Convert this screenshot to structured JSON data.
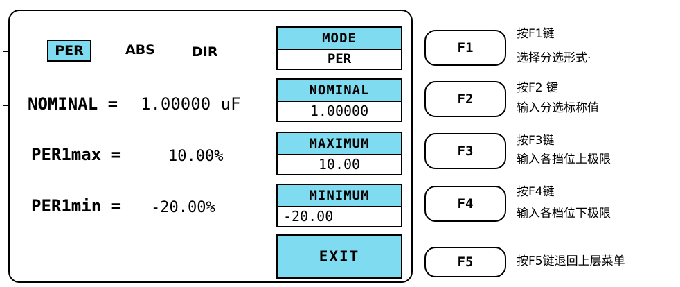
{
  "mode_tabs": {
    "per": "PER",
    "abs": "ABS",
    "dir": "DIR"
  },
  "main": {
    "nominal_label": "NOMINAL =",
    "nominal_value": "1.00000 uF",
    "max_label": "PER1max =",
    "max_value": "10.00%",
    "min_label": "PER1min =",
    "min_value": "-20.00%"
  },
  "softboxes": {
    "mode": {
      "header": "MODE",
      "value": "PER"
    },
    "nominal": {
      "header": "NOMINAL",
      "value": "1.00000"
    },
    "maximum": {
      "header": "MAXIMUM",
      "value": "10.00"
    },
    "minimum": {
      "header": "MINIMUM",
      "value": "-20.00"
    },
    "exit": "EXIT"
  },
  "function_keys": [
    {
      "label": "F1",
      "line1": "按F1键",
      "line2": "选择分选形式·"
    },
    {
      "label": "F2",
      "line1": "按F2 键",
      "line2": "输入分选标称值"
    },
    {
      "label": "F3",
      "line1": "按F3键",
      "line2": "输入各挡位上极限"
    },
    {
      "label": "F4",
      "line1": "按F4键",
      "line2": "输入各档位下极限"
    },
    {
      "label": "F5",
      "line1": "按F5键退回上层菜单"
    }
  ],
  "colors": {
    "accent": "#7fdcf0",
    "border": "#000000",
    "background": "#ffffff"
  }
}
